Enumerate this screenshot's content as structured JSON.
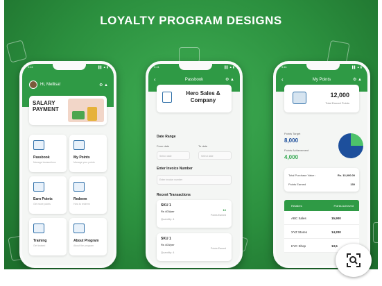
{
  "title": "LOYALTY PROGRAM DESIGNS",
  "status_time": "9:41",
  "status_icons": "▌▌ ▲ ▮",
  "phone1": {
    "greeting": "Hi, Mellisa!",
    "banner": "SALARY PAYMENT",
    "tiles": [
      {
        "name": "Passbook",
        "sub": "Manage transactions"
      },
      {
        "name": "My Points",
        "sub": "Manage your points"
      },
      {
        "name": "Earn Points",
        "sub": "Get more points"
      },
      {
        "name": "Redeem",
        "sub": "How to redeem"
      },
      {
        "name": "Training",
        "sub": "Get trained"
      },
      {
        "name": "About Program",
        "sub": "About the program"
      }
    ]
  },
  "phone2": {
    "header": "Passbook",
    "company": "Hero Sales & Company",
    "date_range": "Date Range",
    "from_label": "From date",
    "to_label": "To date",
    "from_placeholder": "Select date",
    "to_placeholder": "Select date",
    "invoice_label": "Enter Invoice Number",
    "invoice_placeholder": "Enter invoice number",
    "recent": "Recent Transactions",
    "transactions": [
      {
        "sku": "SKU 1",
        "price": "Rs 400/per",
        "qty": "Quantity: 4",
        "points": "16",
        "points_label": "Points Earned"
      },
      {
        "sku": "SKU 1",
        "price": "Rs 400/per",
        "qty": "Quantity: 4",
        "points": "",
        "points_label": "Points Earned"
      }
    ]
  },
  "phone3": {
    "header": "My Points",
    "total_points": "12,000",
    "total_label": "Total Earned Points",
    "target_label": "Points Target",
    "target_value": "8,000",
    "achieved_label": "Points Achievement",
    "achieved_value": "4,000",
    "purchase_label": "Total Purchase Value :",
    "purchase_value": "Rs. 13,000.00",
    "earned_label": "Points Earned",
    "earned_value": "130",
    "table_headers": [
      "Retailers",
      "Points Achieved"
    ],
    "rows": [
      {
        "name": "ABC Sales",
        "value": "15,900"
      },
      {
        "name": "XYZ Stores",
        "value": "14,200"
      },
      {
        "name": "KYC Shop",
        "value": "13,5"
      }
    ]
  }
}
